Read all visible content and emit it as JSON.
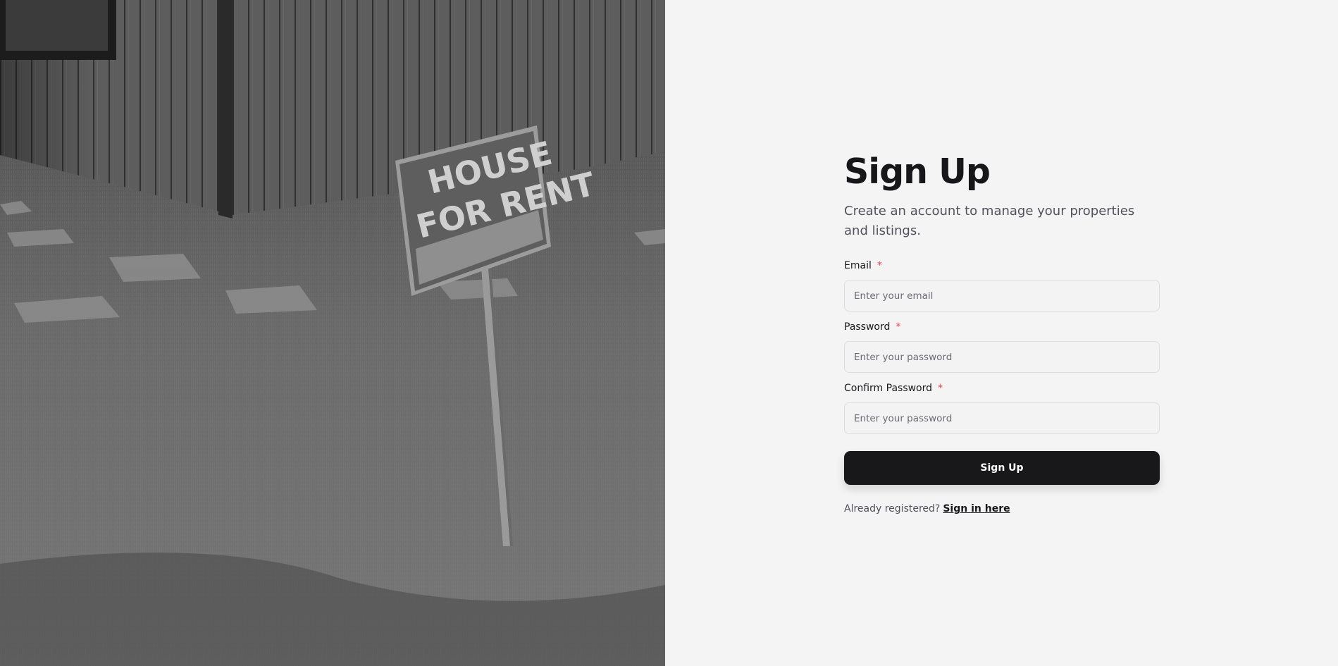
{
  "hero": {
    "sign_line1": "HOUSE",
    "sign_line2": "FOR RENT"
  },
  "form": {
    "title": "Sign Up",
    "subtitle": "Create an account to manage your properties and listings.",
    "email": {
      "label": "Email",
      "required_mark": "*",
      "placeholder": "Enter your email"
    },
    "password": {
      "label": "Password",
      "required_mark": "*",
      "placeholder": "Enter your password"
    },
    "confirm_password": {
      "label": "Confirm Password",
      "required_mark": "*",
      "placeholder": "Enter your password"
    },
    "submit_label": "Sign Up",
    "footer_text": "Already registered?",
    "signin_link": "Sign in here"
  },
  "colors": {
    "primary": "#18181b",
    "required": "#ef4444",
    "background": "#f4f4f4"
  }
}
